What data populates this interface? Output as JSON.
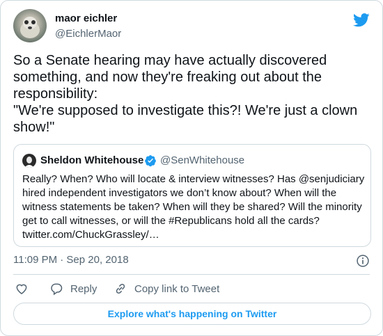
{
  "author": {
    "name": "maor eichler",
    "handle": "@EichlerMaor"
  },
  "tweet": {
    "text": "So a Senate hearing may have actually discovered something, and now they're freaking out about the responsibility:\n\"We're supposed to investigate this?! We're just a clown show!\""
  },
  "quoted": {
    "name": "Sheldon Whitehouse",
    "handle": "@SenWhitehouse",
    "text": "Really? When? Who will locate & interview witnesses? Has @senjudiciary hired independent investigators we don’t know about? When will the witness statements be taken? When will they be shared? Will the minority get to call witnesses, or will the #Republicans hold all the cards? twitter.com/ChuckGrassley/…"
  },
  "meta": {
    "timestamp": "11:09 PM · Sep 20, 2018"
  },
  "actions": {
    "reply_label": "Reply",
    "copy_link_label": "Copy link to Tweet"
  },
  "footer": {
    "explore_label": "Explore what's happening on Twitter"
  },
  "colors": {
    "accent": "#1d9bf0",
    "text": "#0f1419",
    "secondary": "#536471",
    "border": "#cfd9de"
  },
  "icons": [
    "twitter-bird-icon",
    "verified-badge-icon",
    "info-icon",
    "heart-icon",
    "reply-icon",
    "link-icon"
  ]
}
